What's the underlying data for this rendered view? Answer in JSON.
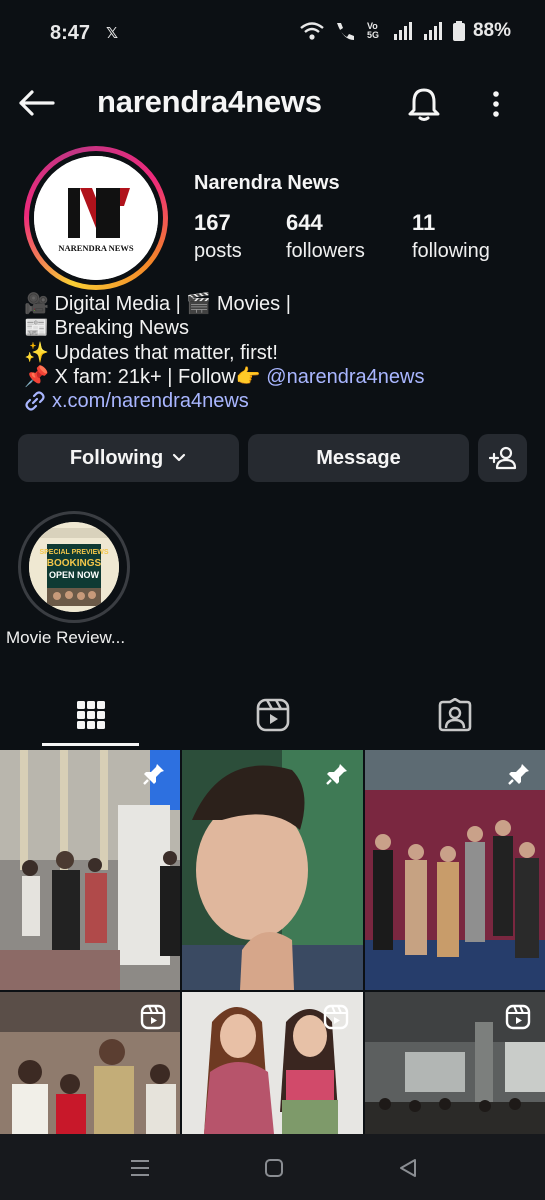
{
  "status_bar": {
    "time": "8:47",
    "notification_icon": "x-logo-icon",
    "network_label": "Vo 5G",
    "battery": "88%"
  },
  "header": {
    "username": "narendra4news",
    "back_icon": "back-arrow-icon",
    "bell_icon": "bell-icon",
    "more_icon": "more-vertical-icon"
  },
  "profile": {
    "display_name": "Narendra News",
    "avatar_text": "NARENDRA NEWS",
    "stats": [
      {
        "value": "167",
        "label": "posts"
      },
      {
        "value": "644",
        "label": "followers"
      },
      {
        "value": "11",
        "label": "following"
      }
    ],
    "bio": {
      "line1": "🎥 Digital Media | 🎬 Movies |",
      "line2": "📰 Breaking News",
      "line3": "✨ Updates that matter, first!",
      "line4_prefix": "📌 X fam: 21k+ | Follow👉 ",
      "line4_mention": "@narendra4news",
      "link": "x.com/narendra4news"
    }
  },
  "actions": {
    "following_label": "Following",
    "message_label": "Message"
  },
  "highlights": [
    {
      "label": "Movie Review...",
      "image_text": "SPECIAL PREVIEWS BOOKINGS OPEN NOW"
    }
  ],
  "tabs": [
    {
      "name": "posts-grid",
      "icon": "grid-icon",
      "active": true
    },
    {
      "name": "reels",
      "icon": "reels-icon",
      "active": false
    },
    {
      "name": "tagged",
      "icon": "tagged-icon",
      "active": false
    }
  ],
  "grid_posts": [
    {
      "badge": "pin-icon"
    },
    {
      "badge": "pin-icon"
    },
    {
      "badge": "pin-icon"
    },
    {
      "badge": "reels-icon"
    },
    {
      "badge": "reels-icon"
    },
    {
      "badge": "reels-icon"
    }
  ],
  "colors": {
    "background": "#0c1014",
    "button": "#262a30",
    "link": "#a9b6ff"
  }
}
